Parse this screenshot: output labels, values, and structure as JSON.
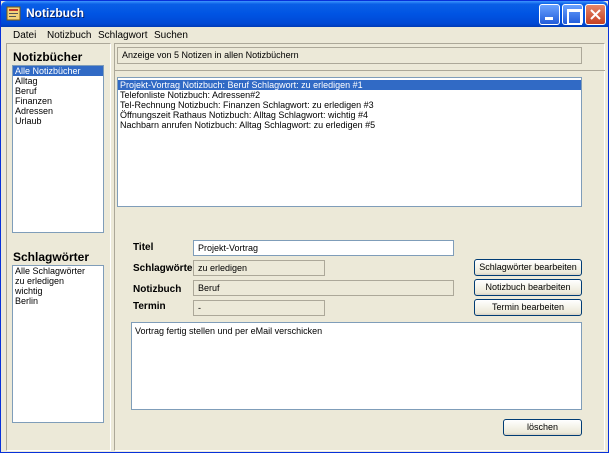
{
  "window": {
    "title": "Notizbuch"
  },
  "menu": [
    "Datei",
    "Notizbuch",
    "Schlagwort",
    "Suchen"
  ],
  "sidebar": {
    "notebooks_title": "Notizbücher",
    "notebooks": [
      "Alle Notizbücher",
      "Alltag",
      "Beruf",
      "Finanzen",
      "Adressen",
      "Urlaub"
    ],
    "notebooks_selected": 0,
    "tags_title": "Schlagwörter",
    "tags": [
      "Alle Schlagwörter",
      "zu erledigen",
      "wichtig",
      "Berlin"
    ]
  },
  "status": "Anzeige von 5 Notizen in allen Notizbüchern",
  "notes": [
    "Projekt-Vortrag  Notizbuch: Beruf  Schlagwort: zu erledigen #1",
    "Telefonliste  Notizbuch: Adressen#2",
    "Tel-Rechnung  Notizbuch: Finanzen  Schlagwort: zu erledigen #3",
    "Öffnungszeit Rathaus  Notizbuch: Alltag  Schlagwort: wichtig #4",
    "Nachbarn anrufen  Notizbuch: Alltag  Schlagwort: zu erledigen #5"
  ],
  "notes_selected": 0,
  "detail": {
    "title_label": "Titel",
    "title_value": "Projekt-Vortrag",
    "tags_label": "Schlagwörter",
    "tags_value": "zu erledigen",
    "notebook_label": "Notizbuch",
    "notebook_value": "Beruf",
    "date_label": "Termin",
    "date_value": "-",
    "body": "Vortrag fertig stellen und per eMail verschicken"
  },
  "buttons": {
    "edit_tags": "Schlagwörter bearbeiten",
    "edit_notebook": "Notizbuch bearbeiten",
    "edit_date": "Termin bearbeiten",
    "delete": "löschen"
  },
  "colors": {
    "selection": "#316ac5",
    "titlebar": "#0054e3",
    "face": "#ece9d8"
  },
  "icons": [
    "app-icon",
    "minimize-icon",
    "maximize-icon",
    "close-icon"
  ]
}
